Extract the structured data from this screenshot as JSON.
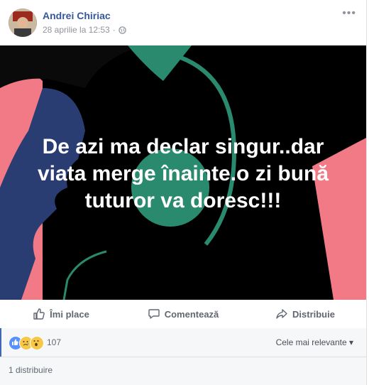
{
  "post": {
    "author": "Andrei Chiriac",
    "date": "28 aprilie la 12:53",
    "dot": "·",
    "more": "•••",
    "quote": "De azi ma declar singur..dar viata merge înainte.o zi bună tuturor va doresc!!!"
  },
  "actions": {
    "like": "Îmi place",
    "comment": "Comentează",
    "share": "Distribuie"
  },
  "reactions": {
    "icons": [
      "like-icon",
      "sad-icon",
      "wow-icon"
    ],
    "count": "107",
    "sort_label": "Cele mai relevante ▾"
  },
  "shares": {
    "label": "1 distribuire"
  },
  "colors": {
    "link": "#365899",
    "pink": "#f27a86",
    "navy": "#27396b",
    "green": "#2a8a6e",
    "like_blue": "#5890ff"
  }
}
